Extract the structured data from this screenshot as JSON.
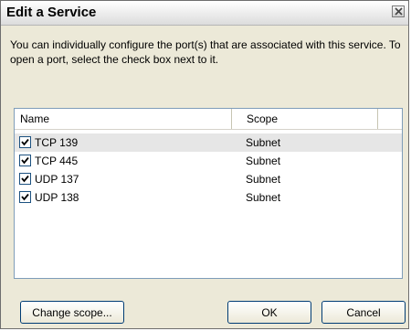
{
  "window": {
    "title": "Edit a Service",
    "description": "You can individually configure the port(s) that are associated with this service. To open a port, select the check box next to it."
  },
  "list": {
    "columns": [
      "Name",
      "Scope"
    ],
    "rows": [
      {
        "name": "TCP 139",
        "scope": "Subnet",
        "checked": true,
        "selected": true
      },
      {
        "name": "TCP 445",
        "scope": "Subnet",
        "checked": true,
        "selected": false
      },
      {
        "name": "UDP 137",
        "scope": "Subnet",
        "checked": true,
        "selected": false
      },
      {
        "name": "UDP 138",
        "scope": "Subnet",
        "checked": true,
        "selected": false
      }
    ]
  },
  "buttons": {
    "change_scope": "Change scope...",
    "ok": "OK",
    "cancel": "Cancel"
  },
  "icons": {
    "close": "close-icon",
    "checkbox": "checkmark-icon"
  },
  "colors": {
    "dialog_bg": "#ece9d8",
    "selection_bg": "#e6e6e6",
    "button_border": "#003c74"
  }
}
